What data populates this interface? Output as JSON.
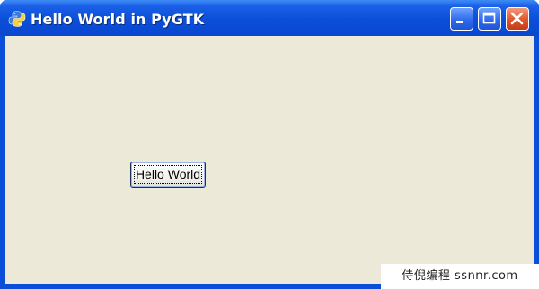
{
  "window": {
    "title": "Hello World in PyGTK",
    "icon": "python-icon",
    "controls": {
      "minimize": "minimize-icon",
      "maximize": "maximize-icon",
      "close": "close-icon"
    },
    "colors": {
      "titlebar": "#0b4fd9",
      "client": "#ece9d8",
      "close": "#e0532b"
    }
  },
  "content": {
    "button_label": "Hello World"
  },
  "watermark": {
    "text": "侍倪编程 ssnnr.com"
  }
}
